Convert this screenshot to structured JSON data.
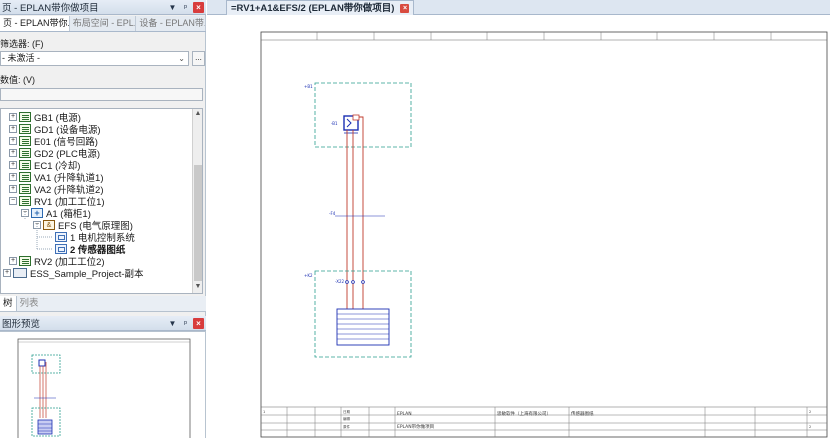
{
  "left_panel": {
    "title": "页 - EPLAN带你做项目",
    "tabs": [
      "页 - EPLAN带你...",
      "布局空间 - EPL...",
      "设备 - EPLAN带..."
    ],
    "filter_label": "筛选器: (F)",
    "filter_value": "- 未激活 -",
    "filter_button": "...",
    "value_label": "数值: (V)",
    "value_text": "",
    "tree": [
      {
        "label": "GB1 (电源)"
      },
      {
        "label": "GD1 (设备电源)"
      },
      {
        "label": "E01 (信号回路)"
      },
      {
        "label": "GD2 (PLC电源)"
      },
      {
        "label": "EC1 (冷却)"
      },
      {
        "label": "VA1 (升降轨道1)"
      },
      {
        "label": "VA2 (升降轨道2)"
      },
      {
        "label": "RV1 (加工工位1)"
      },
      {
        "label": "A1 (箱柜1)"
      },
      {
        "label": "EFS (电气原理图)"
      },
      {
        "label": "1 电机控制系统"
      },
      {
        "label": "2 传感器图纸"
      },
      {
        "label": "RV2 (加工工位2)"
      },
      {
        "label": "ESS_Sample_Project-副本"
      }
    ],
    "bottom_tabs": [
      "树",
      "列表"
    ],
    "preview_title": "图形预览"
  },
  "editor": {
    "tab_title": "=RV1+A1&EFS/2 (EPLAN带你做项目)",
    "labels": {
      "box1": "+B1",
      "sensor": "-B1",
      "wire_tag": "-F4",
      "box2": "+K2",
      "terminal": "-X22"
    },
    "title_block": {
      "company": "EPLAN",
      "project": "EPLAN带你做项目",
      "org": "思敏软件（上海有限公司）",
      "page_desc": "传感器图纸",
      "page_no": "2",
      "page_total": "2",
      "row_ids": [
        "1",
        "2",
        "3",
        "4"
      ],
      "cells": [
        "日期",
        "编辑",
        "原件"
      ]
    }
  }
}
